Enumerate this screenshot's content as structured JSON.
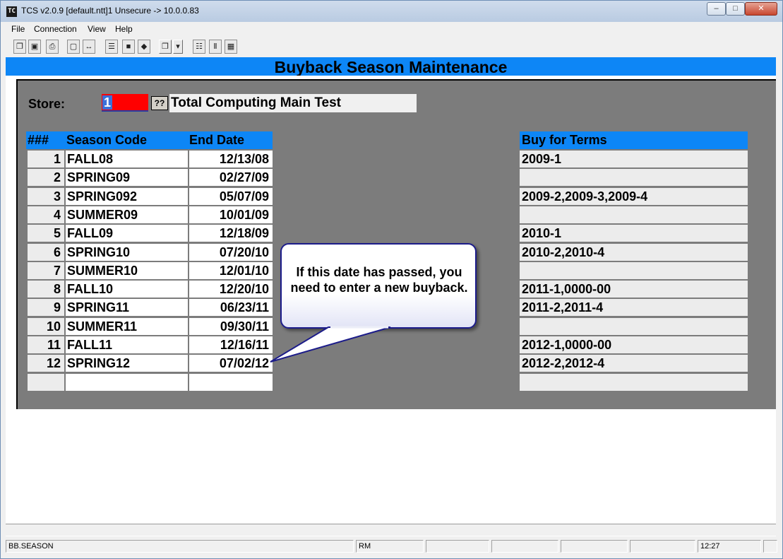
{
  "window": {
    "title": "TCS v2.0.9 [default.ntt]1 Unsecure -> 10.0.0.83",
    "app_icon_text": "TC",
    "minimize_glyph": "–",
    "maximize_glyph": "□",
    "close_glyph": "✕"
  },
  "menu": [
    "File",
    "Connection",
    "View",
    "Help"
  ],
  "toolbar": [
    {
      "icon": "copy-icon",
      "glyph": "❐"
    },
    {
      "icon": "save-icon",
      "glyph": "▣"
    },
    {
      "icon": "print-icon",
      "glyph": "⎙"
    },
    {
      "icon": "lock-icon",
      "glyph": "▢"
    },
    {
      "icon": "connect-icon",
      "glyph": "↔"
    },
    {
      "icon": "properties-icon",
      "glyph": "☰"
    },
    {
      "icon": "monitor-icon",
      "glyph": "■"
    },
    {
      "icon": "book-icon",
      "glyph": "◆"
    },
    {
      "icon": "window-menu-icon",
      "glyph": "❐"
    },
    {
      "icon": "dropdown-arrow-icon",
      "glyph": "▾"
    },
    {
      "icon": "network-icon",
      "glyph": "☷"
    },
    {
      "icon": "chart-icon",
      "glyph": "Ⅱ"
    },
    {
      "icon": "calculator-icon",
      "glyph": "▦"
    }
  ],
  "screen": {
    "title": "Buyback Season Maintenance",
    "store_label": "Store:",
    "store_value": "1",
    "lookup_label": "??",
    "store_name": "Total Computing Main Test"
  },
  "table": {
    "headers": {
      "num": "###",
      "code": "Season Code",
      "end_date": "End Date",
      "terms": "Buy for Terms"
    },
    "rows": [
      {
        "num": "1",
        "code": "FALL08",
        "end_date": "12/13/08",
        "terms": "2009-1"
      },
      {
        "num": "2",
        "code": "SPRING09",
        "end_date": "02/27/09",
        "terms": ""
      },
      {
        "num": "3",
        "code": "SPRING092",
        "end_date": "05/07/09",
        "terms": "2009-2,2009-3,2009-4"
      },
      {
        "num": "4",
        "code": "SUMMER09",
        "end_date": "10/01/09",
        "terms": ""
      },
      {
        "num": "5",
        "code": "FALL09",
        "end_date": "12/18/09",
        "terms": "2010-1"
      },
      {
        "num": "6",
        "code": "SPRING10",
        "end_date": "07/20/10",
        "terms": "2010-2,2010-4"
      },
      {
        "num": "7",
        "code": "SUMMER10",
        "end_date": "12/01/10",
        "terms": ""
      },
      {
        "num": "8",
        "code": "FALL10",
        "end_date": "12/20/10",
        "terms": "2011-1,0000-00"
      },
      {
        "num": "9",
        "code": "SPRING11",
        "end_date": "06/23/11",
        "terms": "2011-2,2011-4"
      },
      {
        "num": "10",
        "code": "SUMMER11",
        "end_date": "09/30/11",
        "terms": ""
      },
      {
        "num": "11",
        "code": "FALL11",
        "end_date": "12/16/11",
        "terms": "2012-1,0000-00"
      },
      {
        "num": "12",
        "code": "SPRING12",
        "end_date": "07/02/12",
        "terms": "2012-2,2012-4"
      },
      {
        "num": "",
        "code": "",
        "end_date": "",
        "terms": ""
      }
    ]
  },
  "callout": {
    "text": "If this date has passed, you need to enter a new buyback."
  },
  "statusbar": {
    "screen": "BB.SEASON",
    "mode": "RM",
    "time": "12:27"
  },
  "colors": {
    "header_blue": "#0d86f6",
    "store_input_red": "#ff0000",
    "panel_gray": "#7c7c7c"
  }
}
